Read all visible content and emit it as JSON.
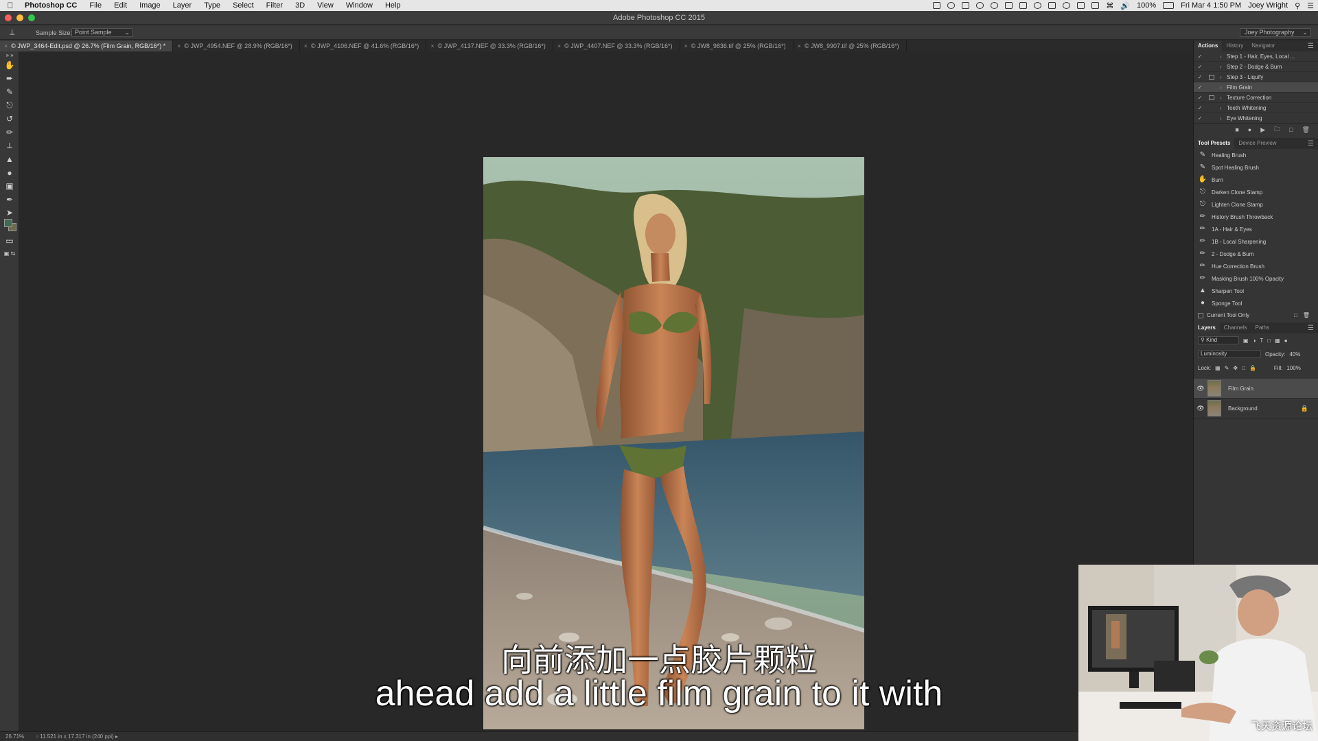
{
  "menubar": {
    "app_name": "Photoshop CC",
    "items": [
      "File",
      "Edit",
      "Image",
      "Layer",
      "Type",
      "Select",
      "Filter",
      "3D",
      "View",
      "Window",
      "Help"
    ],
    "battery": "100%",
    "datetime": "Fri Mar 4  1:50 PM",
    "user": "Joey Wright"
  },
  "window": {
    "title": "Adobe Photoshop CC 2015"
  },
  "options": {
    "sample_size_label": "Sample Size:",
    "sample_size_value": "Point Sample",
    "workspace": "Joey Photography"
  },
  "tabs": [
    {
      "label": "© JWP_3464-Edit.psd @ 26.7% (Film Grain, RGB/16*) *",
      "active": true
    },
    {
      "label": "© JWP_4954.NEF @ 28.9% (RGB/16*)",
      "active": false
    },
    {
      "label": "© JWP_4106.NEF @ 41.6% (RGB/16*)",
      "active": false
    },
    {
      "label": "© JWP_4137.NEF @ 33.3% (RGB/16*)",
      "active": false
    },
    {
      "label": "© JWP_4407.NEF @ 33.3% (RGB/16*)",
      "active": false
    },
    {
      "label": "© JW8_9836.tif @ 25% (RGB/16*)",
      "active": false
    },
    {
      "label": "© JW8_9907.tif @ 25% (RGB/16*)",
      "active": false
    }
  ],
  "actions_panel": {
    "tabs": [
      "Actions",
      "History",
      "Navigator"
    ],
    "items": [
      {
        "label": "Step 1 - Hair, Eyes, Local ...",
        "dialog": false,
        "selected": false
      },
      {
        "label": "Step 2 - Dodge & Burn",
        "dialog": false,
        "selected": false
      },
      {
        "label": "Step 3 - Liquify",
        "dialog": true,
        "selected": false
      },
      {
        "label": "Film Grain",
        "dialog": false,
        "selected": true
      },
      {
        "label": "Texture Correction",
        "dialog": true,
        "selected": false
      },
      {
        "label": "Teeth Whitening",
        "dialog": false,
        "selected": false
      },
      {
        "label": "Eye Whitening",
        "dialog": false,
        "selected": false
      }
    ]
  },
  "tool_presets_panel": {
    "tabs": [
      "Tool Presets",
      "Device Preview"
    ],
    "items": [
      {
        "label": "Healing Brush",
        "icon": "healing-brush-icon"
      },
      {
        "label": "Spot Healing Brush",
        "icon": "spot-healing-icon"
      },
      {
        "label": "Burn",
        "icon": "burn-icon"
      },
      {
        "label": "Darken Clone Stamp",
        "icon": "clone-stamp-icon"
      },
      {
        "label": "Lighten Clone Stamp",
        "icon": "clone-stamp-icon"
      },
      {
        "label": "History Brush Throwback",
        "icon": "history-brush-icon"
      },
      {
        "label": "1A - Hair & Eyes",
        "icon": "brush-icon"
      },
      {
        "label": "1B - Local Sharpening",
        "icon": "brush-icon"
      },
      {
        "label": "2 - Dodge & Burn",
        "icon": "brush-icon"
      },
      {
        "label": "Hue Correction Brush",
        "icon": "brush-icon"
      },
      {
        "label": "Masking Brush 100% Opacity",
        "icon": "brush-icon"
      },
      {
        "label": "Sharpen Tool",
        "icon": "sharpen-icon"
      },
      {
        "label": "Sponge Tool",
        "icon": "sponge-icon"
      }
    ],
    "current_tool_only": "Current Tool Only"
  },
  "layers_panel": {
    "tabs": [
      "Layers",
      "Channels",
      "Paths"
    ],
    "filter": "Kind",
    "blend_mode": "Luminosity",
    "opacity_label": "Opacity:",
    "opacity": "40%",
    "lock_label": "Lock:",
    "fill_label": "Fill:",
    "fill": "100%",
    "layers": [
      {
        "name": "Film Grain",
        "selected": true,
        "locked": false
      },
      {
        "name": "Background",
        "selected": false,
        "locked": true
      }
    ]
  },
  "statusbar": {
    "zoom": "26.71%",
    "doc_info": "11.521 in x 17.317 in (240 ppi)"
  },
  "subtitles": {
    "zh": "向前添加一点胶片颗粒",
    "en": "ahead add a little film grain to it with"
  },
  "watermark": "飞天资源论坛",
  "colors": {
    "accent_window_close": "#fc605c",
    "accent_window_min": "#fdbc40",
    "accent_window_max": "#34c84a"
  }
}
